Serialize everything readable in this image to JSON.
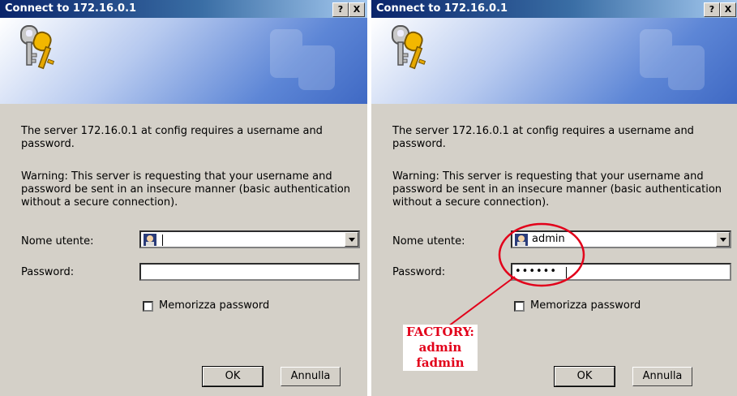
{
  "dialogs": [
    {
      "title": "Connect to 172.16.0.1",
      "help_button": "?",
      "close_button": "X",
      "message": "The server 172.16.0.1 at config requires a username and password.",
      "warning": "Warning: This server is requesting that your username and password be sent in an insecure manner (basic authentication without a secure connection).",
      "username_label": "Nome utente:",
      "username_value": "",
      "password_label": "Password:",
      "password_value": "",
      "remember_label": "Memorizza password",
      "remember_checked": false,
      "ok_label": "OK",
      "cancel_label": "Annulla"
    },
    {
      "title": "Connect to 172.16.0.1",
      "help_button": "?",
      "close_button": "X",
      "message": "The server 172.16.0.1 at config requires a username and password.",
      "warning": "Warning: This server is requesting that your username and password be sent in an insecure manner (basic authentication without a secure connection).",
      "username_label": "Nome utente:",
      "username_value": "admin",
      "password_label": "Password:",
      "password_value": "••••••",
      "remember_label": "Memorizza password",
      "remember_checked": false,
      "ok_label": "OK",
      "cancel_label": "Annulla"
    }
  ],
  "annotation": {
    "line1": "FACTORY:",
    "line2": "admin",
    "line3": "fadmin",
    "color": "#e2001a"
  },
  "colors": {
    "dialog_bg": "#d4d0c8",
    "title_start": "#0a246a",
    "title_end": "#a6caf0"
  },
  "icons": [
    "keys-icon",
    "user-icon",
    "help-icon",
    "close-icon",
    "chevron-down-icon"
  ]
}
